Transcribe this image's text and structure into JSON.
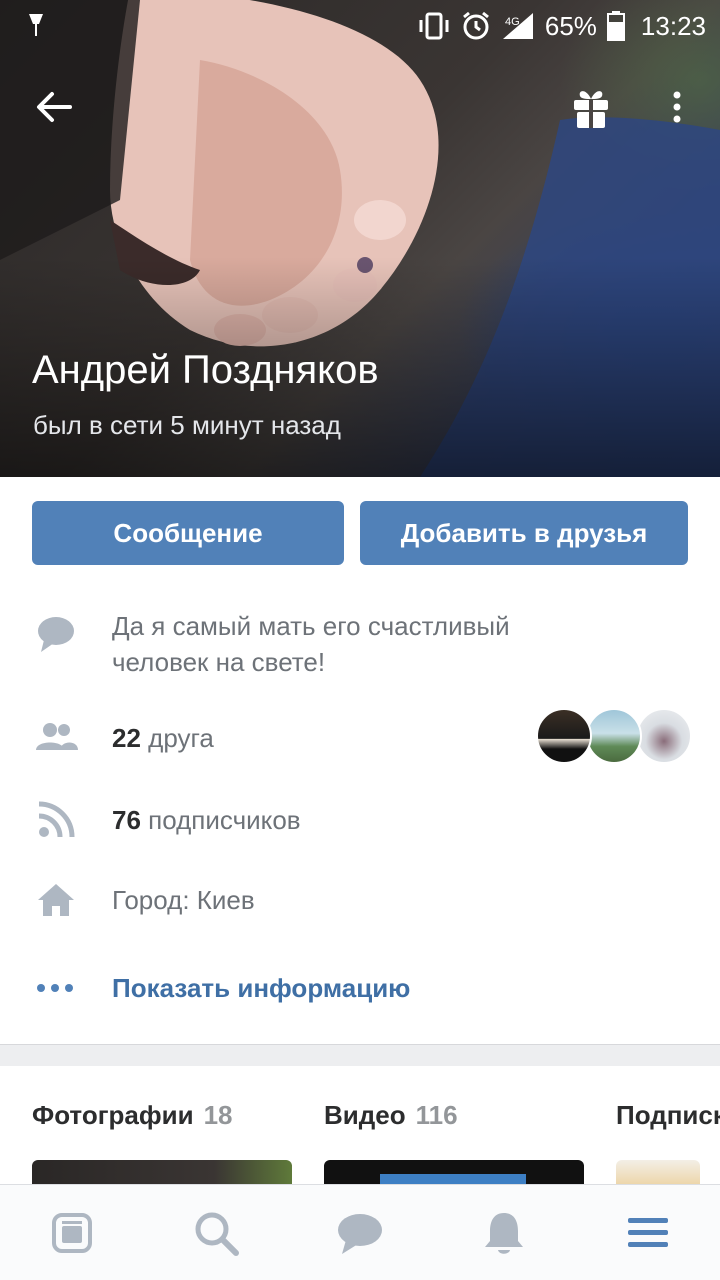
{
  "status_bar": {
    "battery": "65%",
    "time": "13:23",
    "network": "4G"
  },
  "profile": {
    "name": "Андрей Поздняков",
    "last_seen": "был в сети 5 минут назад"
  },
  "buttons": {
    "message": "Сообщение",
    "add_friend": "Добавить в друзья"
  },
  "info": {
    "status": "Да я самый мать его счастливый человек на свете!",
    "friends_count": "22",
    "friends_label": "друга",
    "followers_count": "76",
    "followers_label": "подписчиков",
    "city": "Город: Киев",
    "show_info": "Показать информацию"
  },
  "sections": [
    {
      "title": "Фотографии",
      "count": "18"
    },
    {
      "title": "Видео",
      "count": "116"
    },
    {
      "title": "Подписки",
      "count": ""
    }
  ],
  "icons": {
    "back": "arrow-left-icon",
    "gift": "gift-icon",
    "more": "more-vertical-icon",
    "status": "comment-icon",
    "friends": "people-icon",
    "followers": "rss-icon",
    "city": "home-icon",
    "show_info": "dots-icon",
    "nav": [
      "news-icon",
      "search-icon",
      "messages-icon",
      "notifications-icon",
      "menu-icon"
    ]
  },
  "colors": {
    "accent": "#5181b8",
    "link": "#3f6fa5",
    "icon_gray": "#aeb7c2",
    "nav_active": "#5181b8"
  }
}
